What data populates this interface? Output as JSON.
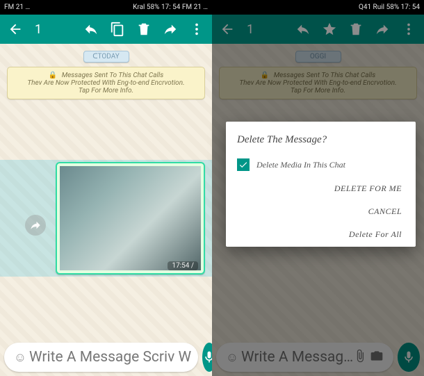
{
  "statusbar": {
    "left_label_a": "FM 21 …",
    "left_label_b": "Kral 58% 17: 54 FM 21 …",
    "right_label_a": "Q41 Ruil 58% 17: 54",
    "battery": "58%",
    "time": "17:54"
  },
  "toolbar_left": {
    "selection_count": "1"
  },
  "toolbar_right": {
    "selection_count": "1"
  },
  "chat": {
    "day_label_left": "ᑕTODAY",
    "day_label_right": "OGGI",
    "banner_line1": "Messages Sent To This Chat Calls",
    "banner_line2": "Thev Are Now Protected With Eng-to-end Encrvotion.",
    "banner_line3": "Tap For More Info.",
    "msg_time": "17:54 /"
  },
  "input": {
    "placeholder_left": "Write A Message Scriv W",
    "placeholder_right": "Write A Messag…"
  },
  "dialog": {
    "title": "Delete The Message?",
    "checkbox_label": "Delete Media In This Chat",
    "checked": true,
    "btn_for_me": "DELETE FOR ME",
    "btn_cancel": "CANCEL",
    "btn_for_all": "Delete For All"
  },
  "colors": {
    "primary": "#009688",
    "banner_bg": "#faf3ca",
    "bubble_sent": "#e4ffe1"
  }
}
